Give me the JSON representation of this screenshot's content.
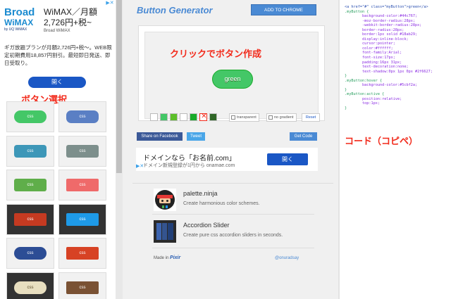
{
  "ad_top": {
    "logo_line1": "Broad",
    "logo_line2": "WiMAX",
    "logo_line3": "by UQ WiMAX",
    "title": "WiMAX／月額2,726円+税~",
    "subtitle": "Broad WiMAX",
    "body": "ギガ放題プランが月額2,726円+税〜。WEB限定初期費用18,857円割引。最短即日発送、即日受取り。",
    "button": "開く",
    "corner": "▶✕"
  },
  "left_section_title": "ボタン選択",
  "button_styles": [
    {
      "label": "css",
      "bg": "#44c767",
      "radius": "9px",
      "dark": false
    },
    {
      "label": "css",
      "bg": "#5a7fc4",
      "radius": "7px",
      "dark": false
    },
    {
      "label": "css",
      "bg": "#3d97b8",
      "radius": "4px",
      "dark": false
    },
    {
      "label": "css",
      "bg": "#7d8f8c",
      "radius": "3px",
      "dark": false
    },
    {
      "label": "css",
      "bg": "#5fae4a",
      "radius": "3px",
      "dark": false
    },
    {
      "label": "css",
      "bg": "#ef6a6a",
      "radius": "2px",
      "dark": false
    },
    {
      "label": "css",
      "bg": "#c53a21",
      "radius": "2px",
      "dark": true
    },
    {
      "label": "css",
      "bg": "#1e9ae8",
      "radius": "2px",
      "dark": true
    },
    {
      "label": "css",
      "bg": "#2c4d95",
      "radius": "10px",
      "dark": false
    },
    {
      "label": "css",
      "bg": "#d74224",
      "radius": "2px",
      "dark": false
    },
    {
      "label": "css",
      "bg": "#e8dfc0",
      "radius": "9px",
      "dark": true
    },
    {
      "label": "css",
      "bg": "#7a5234",
      "radius": "2px",
      "dark": false
    }
  ],
  "header": {
    "app_title": "Button Generator",
    "add_to_chrome": "ADD TO CHROME"
  },
  "preview": {
    "make_title": "クリックでボタン作成",
    "button_text": "green",
    "swatches": [
      "#ffffff",
      "#44c767",
      "#5cbf2a",
      "#ffffff",
      "#18ab29",
      "x",
      "#2f6627"
    ],
    "opt_transparent": "transparent",
    "opt_no_gradient": "no gradient",
    "reset": "Reset"
  },
  "share": {
    "facebook": "Share on Facebook",
    "tweet": "Tweet",
    "get_code": "Get Code"
  },
  "ad_mid": {
    "title": "ドメインなら「お名前.com」",
    "sub": "ドメイン新規登録が1円から onamae.com",
    "button": "開く",
    "corner": "▶✕"
  },
  "promos": [
    {
      "name": "palette.ninja",
      "desc": "Create harmonious color schemes."
    },
    {
      "name": "Accordion Slider",
      "desc": "Create pure css accordion sliders in seconds."
    }
  ],
  "footer": {
    "made_in": "Made in",
    "brand": "Pixir",
    "twitter": "@onuradsay"
  },
  "code_title": "コード（コピペ）",
  "code_lines": [
    {
      "t": "<a href=\"#\" class=\"myButton\">green</a>",
      "c": "tag"
    },
    {
      "t": "",
      "c": ""
    },
    {
      "t": ".myButton {",
      "c": "sel"
    },
    {
      "t": "        background-color:#44c767;",
      "c": "prop"
    },
    {
      "t": "        -moz-border-radius:28px;",
      "c": "prop"
    },
    {
      "t": "        -webkit-border-radius:28px;",
      "c": "prop"
    },
    {
      "t": "        border-radius:28px;",
      "c": "prop"
    },
    {
      "t": "        border:1px solid #18ab29;",
      "c": "prop"
    },
    {
      "t": "        display:inline-block;",
      "c": "prop"
    },
    {
      "t": "        cursor:pointer;",
      "c": "prop"
    },
    {
      "t": "        color:#ffffff;",
      "c": "prop"
    },
    {
      "t": "        font-family:Arial;",
      "c": "prop"
    },
    {
      "t": "        font-size:17px;",
      "c": "prop"
    },
    {
      "t": "        padding:16px 31px;",
      "c": "prop"
    },
    {
      "t": "        text-decoration:none;",
      "c": "prop"
    },
    {
      "t": "        text-shadow:0px 1px 0px #2f6627;",
      "c": "prop"
    },
    {
      "t": "}",
      "c": "sel"
    },
    {
      "t": ".myButton:hover {",
      "c": "sel"
    },
    {
      "t": "        background-color:#5cbf2a;",
      "c": "prop"
    },
    {
      "t": "}",
      "c": "sel"
    },
    {
      "t": ".myButton:active {",
      "c": "sel"
    },
    {
      "t": "        position:relative;",
      "c": "prop"
    },
    {
      "t": "        top:1px;",
      "c": "prop"
    },
    {
      "t": "}",
      "c": "sel"
    }
  ]
}
